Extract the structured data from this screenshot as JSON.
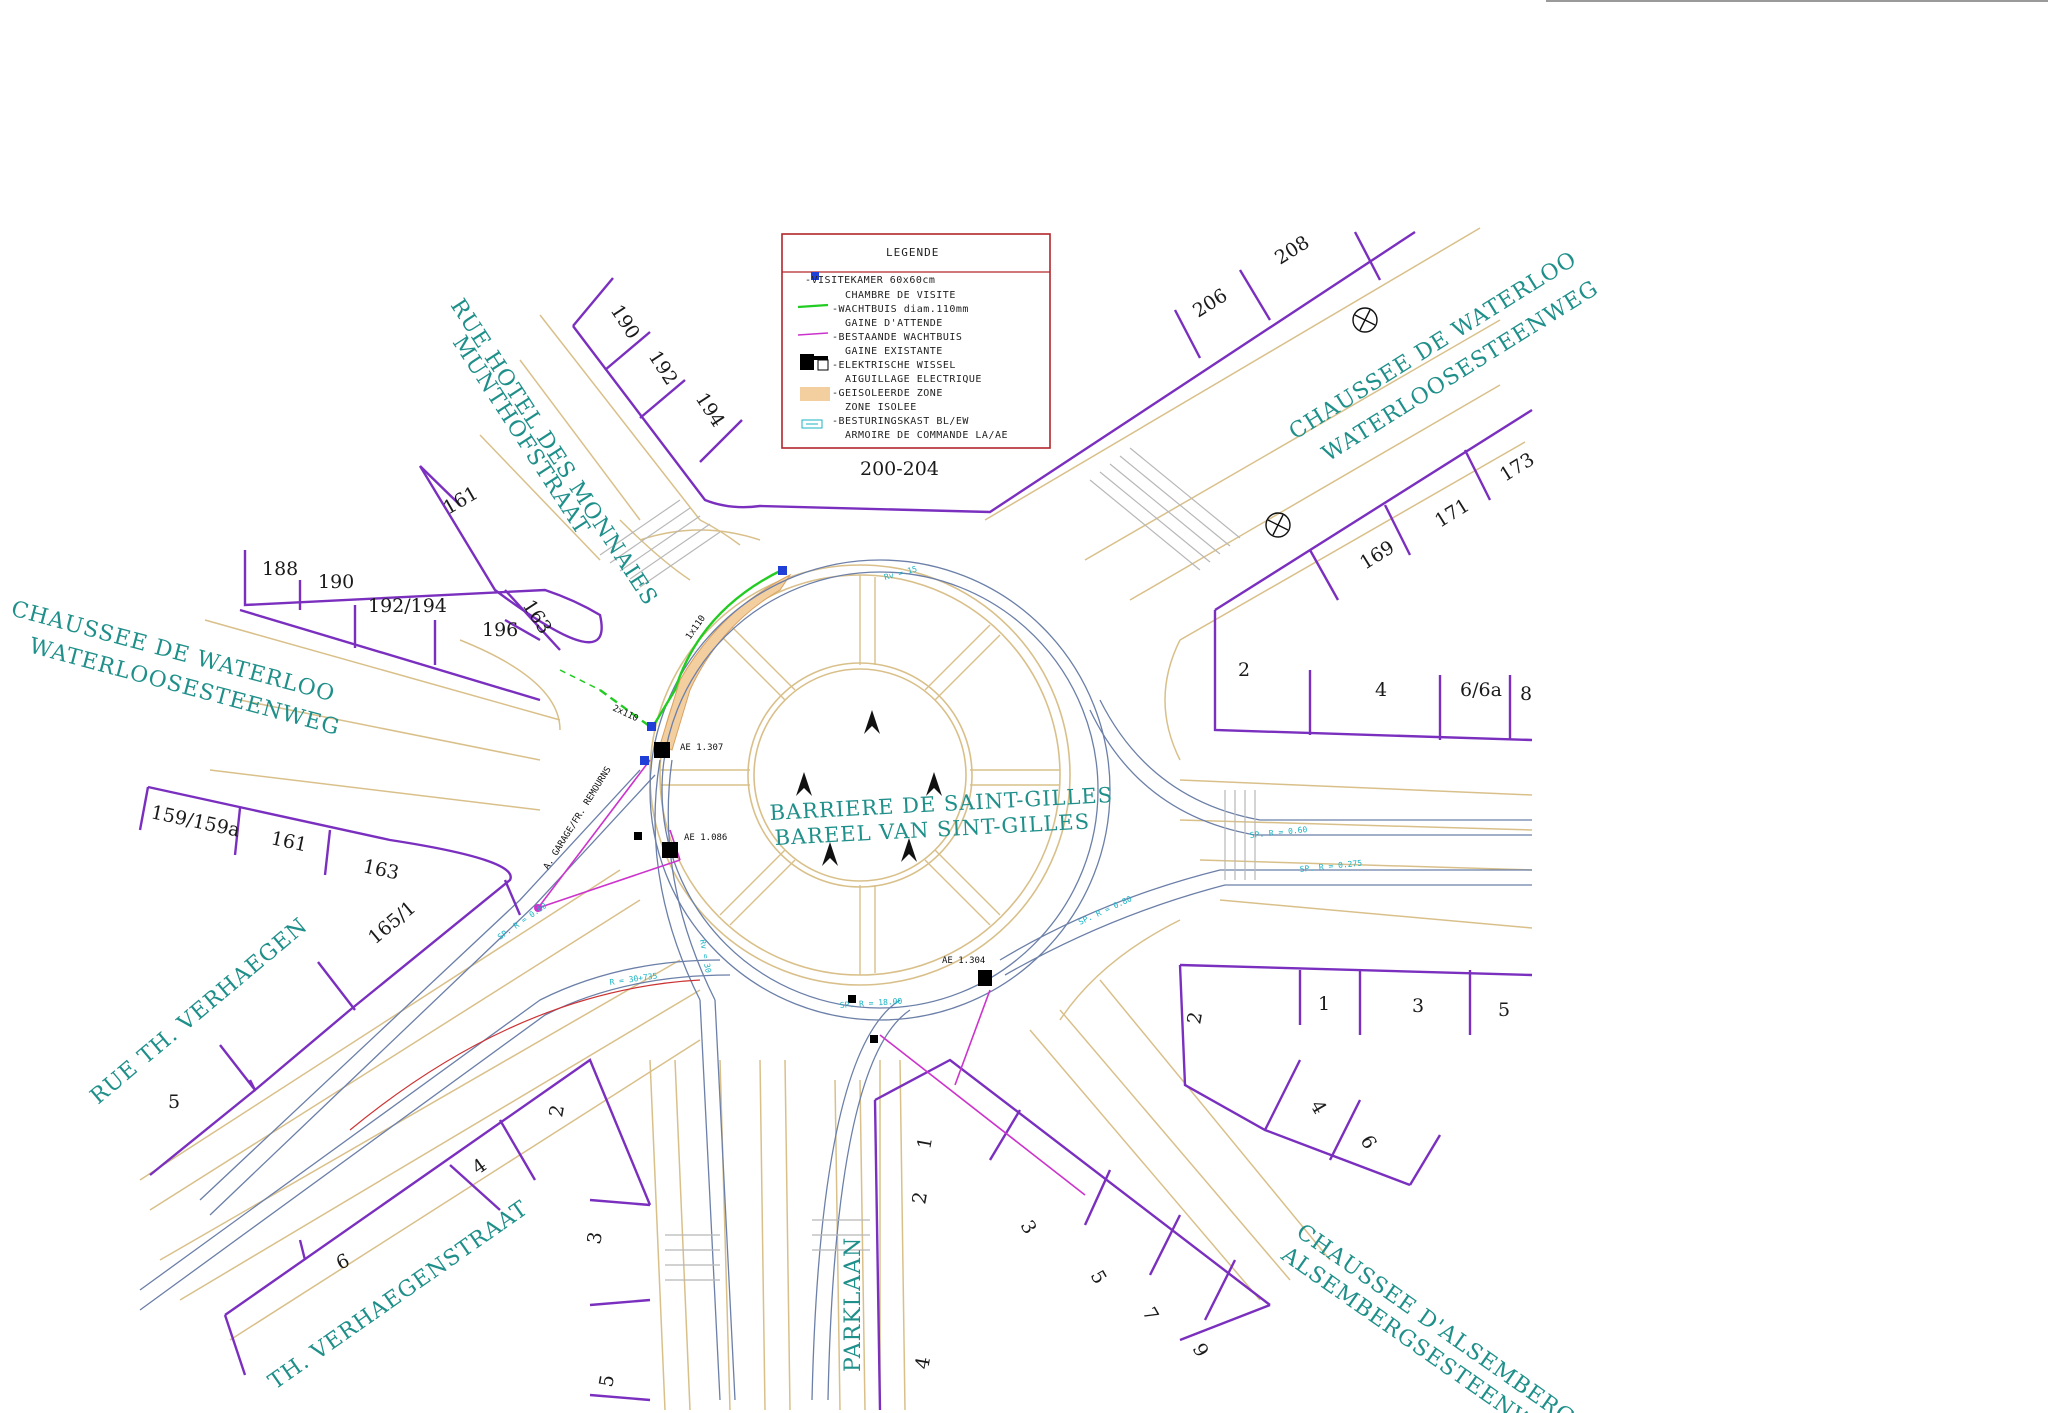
{
  "legend": {
    "title": "LEGENDE",
    "items": [
      {
        "icon": "blue-square-icon",
        "nl": "-VISITEKAMER 60x60cm",
        "fr": "CHAMBRE DE VISITE",
        "color": "#1f3fd6"
      },
      {
        "icon": "green-line-icon",
        "nl": "-WACHTBUIS diam.110mm",
        "fr": "GAINE D'ATTENDE",
        "color": "#22cc22"
      },
      {
        "icon": "magenta-line-icon",
        "nl": "-BESTAANDE WACHTBUIS",
        "fr": "GAINE EXISTANTE",
        "color": "#cc33cc"
      },
      {
        "icon": "switch-icon",
        "nl": "-ELEKTRISCHE WISSEL",
        "fr": "AIGUILLAGE ELECTRIQUE",
        "color": "#000000"
      },
      {
        "icon": "tan-zone-icon",
        "nl": "-GEISOLEERDE ZONE",
        "fr": "ZONE ISOLEE",
        "color": "#f3cfa0"
      },
      {
        "icon": "cabinet-icon",
        "nl": "-BESTURINGSKAST BL/EW",
        "fr": "ARMOIRE DE COMMANDE LA/AE",
        "color": "#1ab3c4"
      }
    ],
    "border_color": "#b3262b"
  },
  "center": {
    "line1": "BARRIERE DE SAINT-GILLES",
    "line2": "BAREEL VAN SINT-GILLES"
  },
  "streets": {
    "munt_fr": "RUE HOTEL DES MONNAIES",
    "munt_nl": "MUNTHOFSTRAAT",
    "waterloo_w_fr": "CHAUSSEE DE WATERLOO",
    "waterloo_w_nl": "WATERLOOSESTEENWEG",
    "waterloo_e_fr": "CHAUSSEE DE WATERLOO",
    "waterloo_e_nl": "WATERLOOSESTEENWEG",
    "verhaegen_fr": "RUE TH. VERHAEGEN",
    "verhaegen_nl": "TH. VERHAEGENSTRAAT",
    "parklaan": "PARKLAAN",
    "alsemberg_fr": "CHAUSSEE D'ALSEMBERG",
    "alsemberg_nl": "ALSEMBERGSESTEENWEG"
  },
  "house_numbers": {
    "n190a": "190",
    "n192a": "192",
    "n194": "194",
    "n200": "200-204",
    "n206": "206",
    "n208": "208",
    "n161a": "161",
    "n163a": "163",
    "n196": "196",
    "n188": "188",
    "n190b": "190",
    "n192194": "192/194",
    "n169": "169",
    "n171": "171",
    "n173": "173",
    "n2e": "2",
    "n4e": "4",
    "n66a": "6/6a",
    "n8": "8",
    "n159": "159/159a",
    "n161b": "161",
    "n163b": "163",
    "n1651": "165/1",
    "n5w": "5",
    "n2se": "2",
    "n1se": "1",
    "n3se": "3",
    "n5se": "5",
    "n4se": "4",
    "n6se": "6",
    "n2sw": "2",
    "n4sw": "4",
    "n6sw": "6",
    "n3s": "3",
    "n5s": "5",
    "n1p": "1",
    "n2p": "2",
    "n3p": "3",
    "n5p": "5",
    "n7p": "7",
    "n9p": "9",
    "n4p": "4"
  },
  "annotations": {
    "ae1307": "AE 1.307",
    "ae1086": "AE 1.086",
    "ae1304": "AE 1.304",
    "d1x110": "1x110",
    "d2x110": "2x110",
    "rv1": "Rv = 15",
    "rv2": "Rv = 30",
    "r_label": "R = 30+735",
    "sp1": "SP. R = 0.60",
    "sp2": "SP. R = 0.275",
    "sp3": "SP. R = 0.80",
    "sp4": "SP. R = 0.60",
    "sp5": "SP. R = 18.00",
    "garage": "A. GARAGE/FR. REMOURNS"
  }
}
